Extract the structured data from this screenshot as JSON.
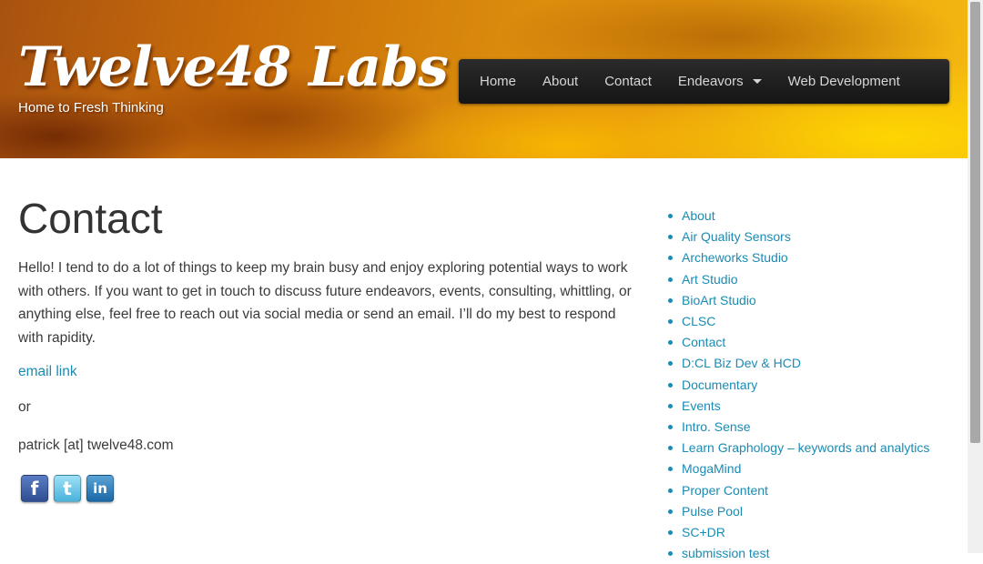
{
  "site": {
    "title": "Twelve48 Labs",
    "tagline": "Home to Fresh Thinking"
  },
  "nav": {
    "items": [
      {
        "label": "Home"
      },
      {
        "label": "About"
      },
      {
        "label": "Contact"
      },
      {
        "label": "Endeavors",
        "has_dropdown": true
      },
      {
        "label": "Web Development"
      }
    ]
  },
  "page": {
    "title": "Contact",
    "intro": "Hello! I tend to do a lot of things to keep my brain busy and enjoy exploring potential ways to work with others. If you want to get in touch to discuss future endeavors, events, consulting, whittling, or anything else, feel free to reach out via social media or send an email. I’ll do my best to respond with rapidity.",
    "email_link": "email link",
    "or_text": "or",
    "email_address": "patrick [at] twelve48.com",
    "social": [
      {
        "name": "facebook",
        "glyph": "f",
        "color": "#3b5998"
      },
      {
        "name": "twitter",
        "glyph": "t",
        "color": "#55acee"
      },
      {
        "name": "linkedin",
        "glyph": "in",
        "color": "#0e76a8"
      }
    ]
  },
  "sidebar": {
    "links": [
      "About",
      "Air Quality Sensors",
      "Archeworks Studio",
      "Art Studio",
      "BioArt Studio",
      "CLSC",
      "Contact",
      "D:CL Biz Dev & HCD",
      "Documentary",
      "Events",
      "Intro. Sense",
      "Learn Graphology – keywords and analytics",
      "MogaMind",
      "Proper Content",
      "Pulse Pool",
      "SC+DR",
      "submission test"
    ]
  },
  "colors": {
    "link": "#1a8bb3",
    "nav_bg": "#1f1f1f",
    "nav_text": "#d6d6d6",
    "header_gradient_start": "#a85210",
    "header_gradient_end": "#f4b810"
  }
}
